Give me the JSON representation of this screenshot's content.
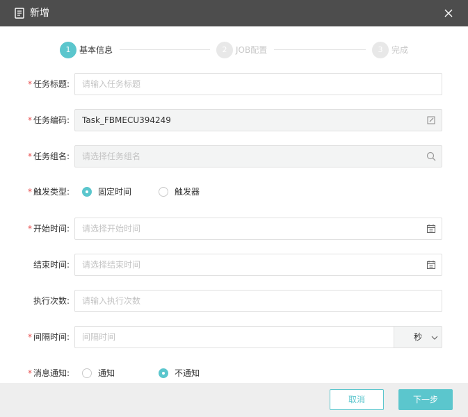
{
  "dialog": {
    "title": "新增"
  },
  "steps": [
    {
      "number": "1",
      "label": "基本信息",
      "state": "active"
    },
    {
      "number": "2",
      "label": "JOB配置",
      "state": "inactive"
    },
    {
      "number": "3",
      "label": "完成",
      "state": "inactive"
    }
  ],
  "form": {
    "required_mark": "*",
    "task_title": {
      "label": "任务标题:",
      "required": true,
      "value": "",
      "placeholder": "请输入任务标题"
    },
    "task_code": {
      "label": "任务编码:",
      "required": true,
      "value": "Task_FBMECU394249",
      "placeholder": ""
    },
    "task_group": {
      "label": "任务组名:",
      "required": true,
      "value": "",
      "placeholder": "请选择任务组名"
    },
    "trigger_type": {
      "label": "触发类型:",
      "required": true,
      "options": [
        "固定时间",
        "触发器"
      ],
      "selected": "固定时间"
    },
    "start_time": {
      "label": "开始时间:",
      "required": true,
      "value": "",
      "placeholder": "请选择开始时间"
    },
    "end_time": {
      "label": "结束时间:",
      "required": false,
      "value": "",
      "placeholder": "请选择结束时间"
    },
    "exec_count": {
      "label": "执行次数:",
      "required": false,
      "value": "",
      "placeholder": "请输入执行次数"
    },
    "interval": {
      "label": "间隔时间:",
      "required": true,
      "value": "",
      "placeholder": "间隔时间",
      "unit": "秒"
    },
    "notify": {
      "label": "消息通知:",
      "required": true,
      "options": [
        "通知",
        "不通知"
      ],
      "selected": "不通知"
    }
  },
  "footer": {
    "cancel_label": "取消",
    "next_label": "下一步"
  },
  "colors": {
    "accent": "#5bc6cd",
    "titlebar": "#4d4d4d",
    "required": "#e84d4d"
  },
  "icons": {
    "title": "document-icon",
    "close": "close-icon",
    "task_code": "edit-icon",
    "task_group": "search-icon",
    "date": "calendar-icon",
    "unit": "chevron-down-icon"
  }
}
